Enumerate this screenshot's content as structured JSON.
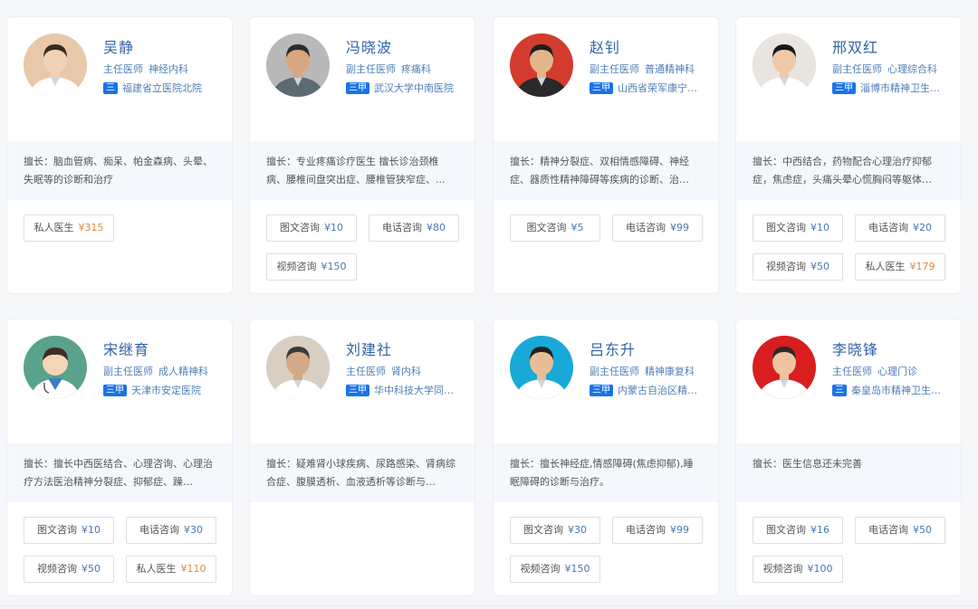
{
  "doctors": [
    {
      "name": "吴静",
      "title": "主任医师",
      "dept": "神经内科",
      "badge": "三",
      "hospital": "福建省立医院北院",
      "skill": "擅长：脑血管病、痴呆、帕金森病、头晕、失眠等的诊断和治疗",
      "avatar": "photo-female-doctor-icon",
      "services": [
        {
          "label": "私人医生",
          "price": "¥315",
          "highlight": true
        }
      ]
    },
    {
      "name": "冯晓波",
      "title": "副主任医师",
      "dept": "疼痛科",
      "badge": "三甲",
      "hospital": "武汉大学中南医院",
      "skill": "擅长：专业疼痛诊疗医生 擅长诊治颈椎病、腰椎间盘突出症、腰椎管狭窄症、...",
      "avatar": "photo-male-doctor-icon",
      "services": [
        {
          "label": "图文咨询",
          "price": "¥10",
          "highlight": false
        },
        {
          "label": "电话咨询",
          "price": "¥80",
          "highlight": false
        },
        {
          "label": "视频咨询",
          "price": "¥150",
          "highlight": false
        }
      ]
    },
    {
      "name": "赵钊",
      "title": "副主任医师",
      "dept": "普通精神科",
      "badge": "三甲",
      "hospital": "山西省荣军康宁…",
      "skill": "擅长：精神分裂症、双相情感障碍、神经症、器质性精神障碍等疾病的诊断、治…",
      "avatar": "photo-male-doctor-icon",
      "services": [
        {
          "label": "图文咨询",
          "price": "¥5",
          "highlight": false
        },
        {
          "label": "电话咨询",
          "price": "¥99",
          "highlight": false
        }
      ]
    },
    {
      "name": "邢双红",
      "title": "副主任医师",
      "dept": "心理综合科",
      "badge": "三甲",
      "hospital": "淄博市精神卫生…",
      "skill": "擅长：中西结合，药物配合心理治疗抑郁症，焦虑症，头痛头晕心慌胸闷等躯体…",
      "avatar": "photo-female-doctor-icon",
      "services": [
        {
          "label": "图文咨询",
          "price": "¥10",
          "highlight": false
        },
        {
          "label": "电话咨询",
          "price": "¥20",
          "highlight": false
        },
        {
          "label": "视频咨询",
          "price": "¥50",
          "highlight": false
        },
        {
          "label": "私人医生",
          "price": "¥179",
          "highlight": true
        }
      ]
    },
    {
      "name": "宋继育",
      "title": "副主任医师",
      "dept": "成人精神科",
      "badge": "三甲",
      "hospital": "天津市安定医院",
      "skill": "擅长：擅长中西医结合、心理咨询、心理治疗方法医治精神分裂症、抑郁症、躁…",
      "avatar": "default-doctor-avatar-icon",
      "services": [
        {
          "label": "图文咨询",
          "price": "¥10",
          "highlight": false
        },
        {
          "label": "电话咨询",
          "price": "¥30",
          "highlight": false
        },
        {
          "label": "视频咨询",
          "price": "¥50",
          "highlight": false
        },
        {
          "label": "私人医生",
          "price": "¥110",
          "highlight": true
        }
      ]
    },
    {
      "name": "刘建社",
      "title": "主任医师",
      "dept": "肾内科",
      "badge": "三甲",
      "hospital": "华中科技大学同…",
      "skill": "擅长：疑难肾小球疾病、尿路感染、肾病综合症、腹膜透析、血液透析等诊断与…",
      "avatar": "photo-male-doctor-icon",
      "services": []
    },
    {
      "name": "吕东升",
      "title": "副主任医师",
      "dept": "精神康复科",
      "badge": "三甲",
      "hospital": "内蒙古自治区精…",
      "skill": "擅长：擅长神经症,情感障碍(焦虑抑郁),睡眠障碍的诊断与治疗。",
      "avatar": "photo-male-doctor-icon",
      "services": [
        {
          "label": "图文咨询",
          "price": "¥30",
          "highlight": false
        },
        {
          "label": "电话咨询",
          "price": "¥99",
          "highlight": false
        },
        {
          "label": "视频咨询",
          "price": "¥150",
          "highlight": false
        }
      ]
    },
    {
      "name": "李晓锋",
      "title": "主任医师",
      "dept": "心理门诊",
      "badge": "三",
      "hospital": "秦皇岛市精神卫生…",
      "skill": "擅长：医生信息还未完善",
      "avatar": "photo-male-doctor-icon",
      "services": [
        {
          "label": "图文咨询",
          "price": "¥16",
          "highlight": false
        },
        {
          "label": "电话咨询",
          "price": "¥50",
          "highlight": false
        },
        {
          "label": "视频咨询",
          "price": "¥100",
          "highlight": false
        }
      ]
    }
  ]
}
